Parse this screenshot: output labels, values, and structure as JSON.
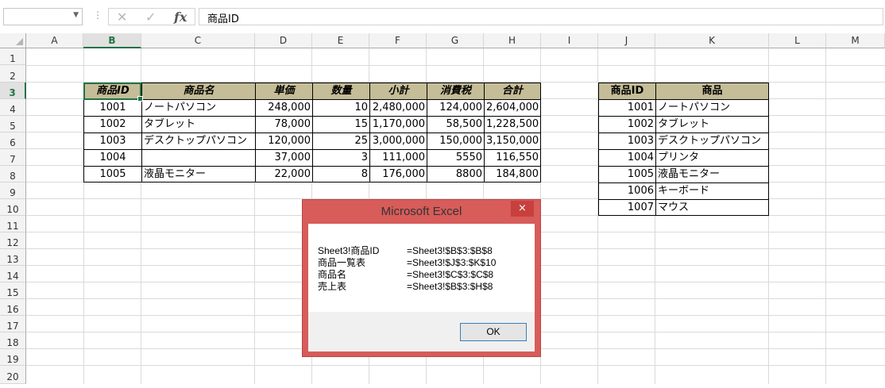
{
  "name_box": "",
  "formula": "商品ID",
  "columns": [
    "A",
    "B",
    "C",
    "D",
    "E",
    "F",
    "G",
    "H",
    "I",
    "J",
    "K",
    "L",
    "M"
  ],
  "rows": [
    "1",
    "2",
    "3",
    "4",
    "5",
    "6",
    "7",
    "8",
    "9",
    "10",
    "11",
    "12",
    "13",
    "14",
    "15",
    "16",
    "17",
    "18",
    "19",
    "20"
  ],
  "sales_table": {
    "headers": [
      "商品ID",
      "商品名",
      "単価",
      "数量",
      "小計",
      "消費税",
      "合計"
    ],
    "rows": [
      [
        "1001",
        "ノートパソコン",
        "248,000",
        "10",
        "2,480,000",
        "124,000",
        "2,604,000"
      ],
      [
        "1002",
        "タブレット",
        "78,000",
        "15",
        "1,170,000",
        "58,500",
        "1,228,500"
      ],
      [
        "1003",
        "デスクトップパソコン",
        "120,000",
        "25",
        "3,000,000",
        "150,000",
        "3,150,000"
      ],
      [
        "1004",
        "",
        "37,000",
        "3",
        "111,000",
        "5550",
        "116,550"
      ],
      [
        "1005",
        "液晶モニター",
        "22,000",
        "8",
        "176,000",
        "8800",
        "184,800"
      ]
    ]
  },
  "product_table": {
    "headers": [
      "商品ID",
      "商品"
    ],
    "rows": [
      [
        "1001",
        "ノートパソコン"
      ],
      [
        "1002",
        "タブレット"
      ],
      [
        "1003",
        "デスクトップパソコン"
      ],
      [
        "1004",
        "プリンタ"
      ],
      [
        "1005",
        "液晶モニター"
      ],
      [
        "1006",
        "キーボード"
      ],
      [
        "1007",
        "マウス"
      ]
    ]
  },
  "dialog": {
    "title": "Microsoft Excel",
    "close": "×",
    "lines": [
      {
        "name": "Sheet3!商品ID",
        "ref": "=Sheet3!$B$3:$B$8"
      },
      {
        "name": "商品一覧表",
        "ref": "=Sheet3!$J$3:$K$10"
      },
      {
        "name": "商品名",
        "ref": "=Sheet3!$C$3:$C$8"
      },
      {
        "name": "売上表",
        "ref": "=Sheet3!$B$3:$H$8"
      }
    ],
    "ok": "OK"
  },
  "icons": {
    "cancel": "✕",
    "enter": "✓",
    "function": "fx",
    "dropdown": "▼",
    "more": "⋮"
  }
}
